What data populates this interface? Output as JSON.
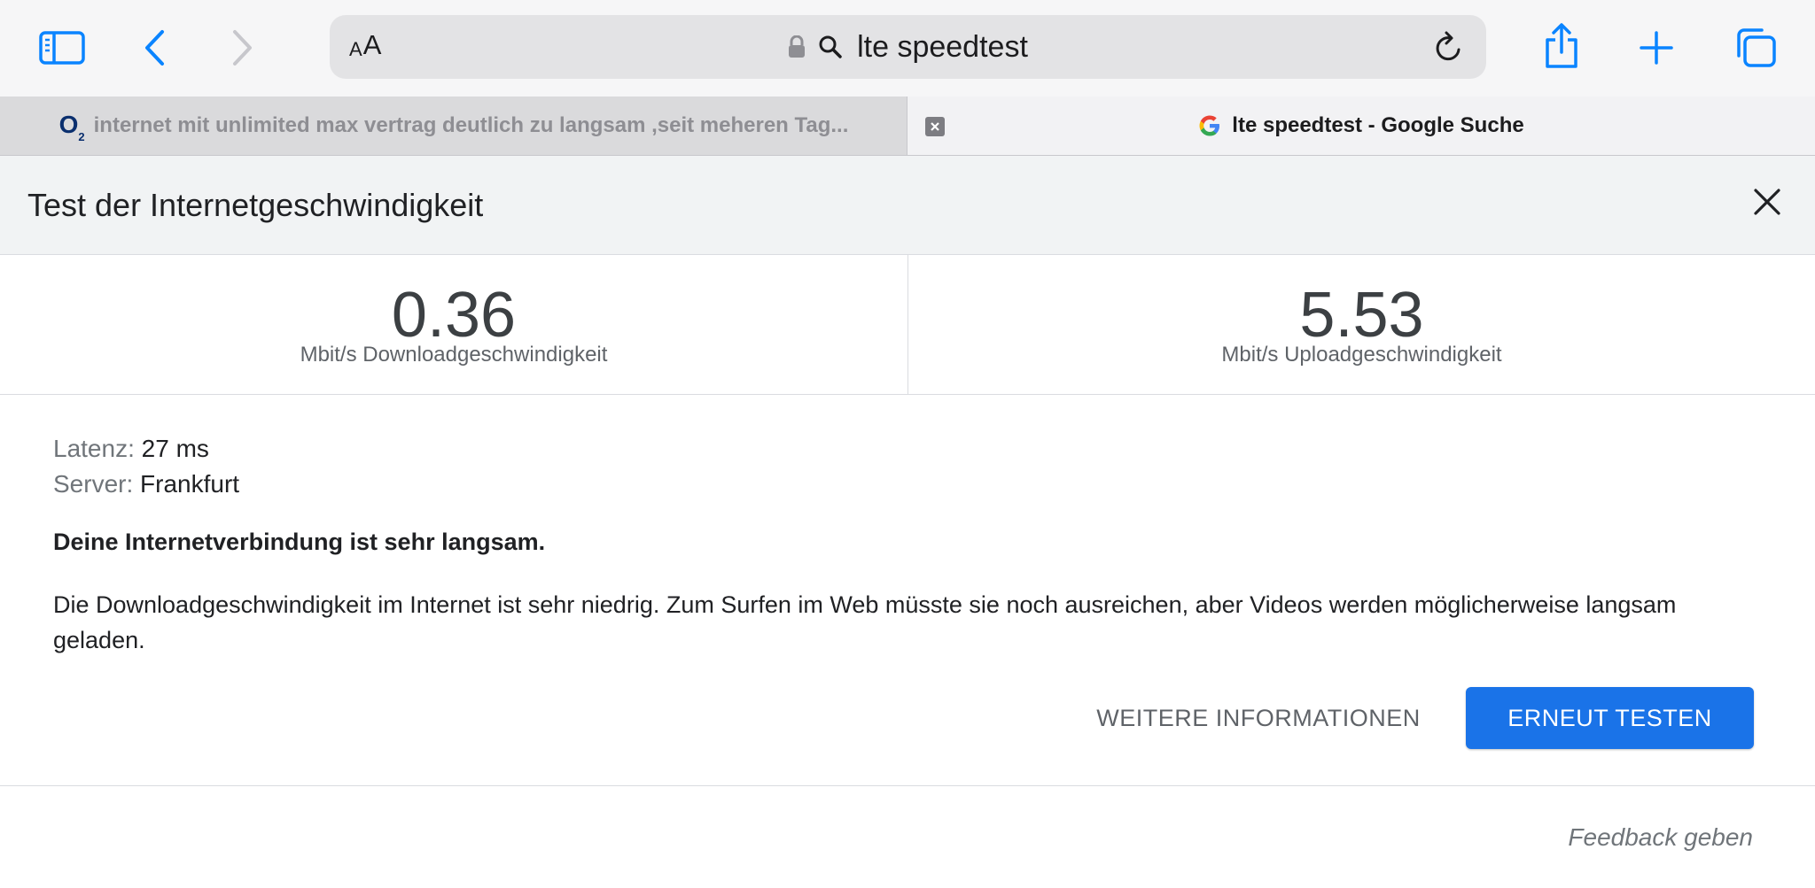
{
  "browser": {
    "address_bar": {
      "aa_label_small": "A",
      "aa_label_large": "A",
      "text": "lte speedtest"
    },
    "tabs": [
      {
        "favicon": "O",
        "favicon_sub": "2",
        "title": "internet mit unlimited max vertrag deutlich zu langsam ,seit meheren Tag..."
      },
      {
        "title": "lte speedtest - Google Suche"
      }
    ]
  },
  "speedtest": {
    "title": "Test der Internetgeschwindigkeit",
    "download": {
      "value": "0.36",
      "label": "Mbit/s Downloadgeschwindigkeit"
    },
    "upload": {
      "value": "5.53",
      "label": "Mbit/s Uploadgeschwindigkeit"
    },
    "latency": {
      "key": "Latenz:",
      "value": "27 ms"
    },
    "server": {
      "key": "Server:",
      "value": "Frankfurt"
    },
    "verdict": "Deine Internetverbindung ist sehr langsam.",
    "description": "Die Downloadgeschwindigkeit im Internet ist sehr niedrig. Zum Surfen im Web müsste sie noch ausreichen, aber Videos werden möglicherweise langsam geladen.",
    "more_info_label": "WEITERE INFORMATIONEN",
    "retest_label": "ERNEUT TESTEN",
    "feedback_label": "Feedback geben"
  },
  "colors": {
    "accent": "#1a73e8",
    "ios_blue": "#0a84ff"
  },
  "icons": {
    "sidebar": "sidebar-icon",
    "back": "chevron-left-icon",
    "forward": "chevron-right-icon",
    "lock": "lock-icon",
    "search": "search-icon",
    "reload": "reload-icon",
    "share": "share-icon",
    "new_tab": "plus-icon",
    "tabs": "tabs-overview-icon",
    "close": "close-icon"
  }
}
